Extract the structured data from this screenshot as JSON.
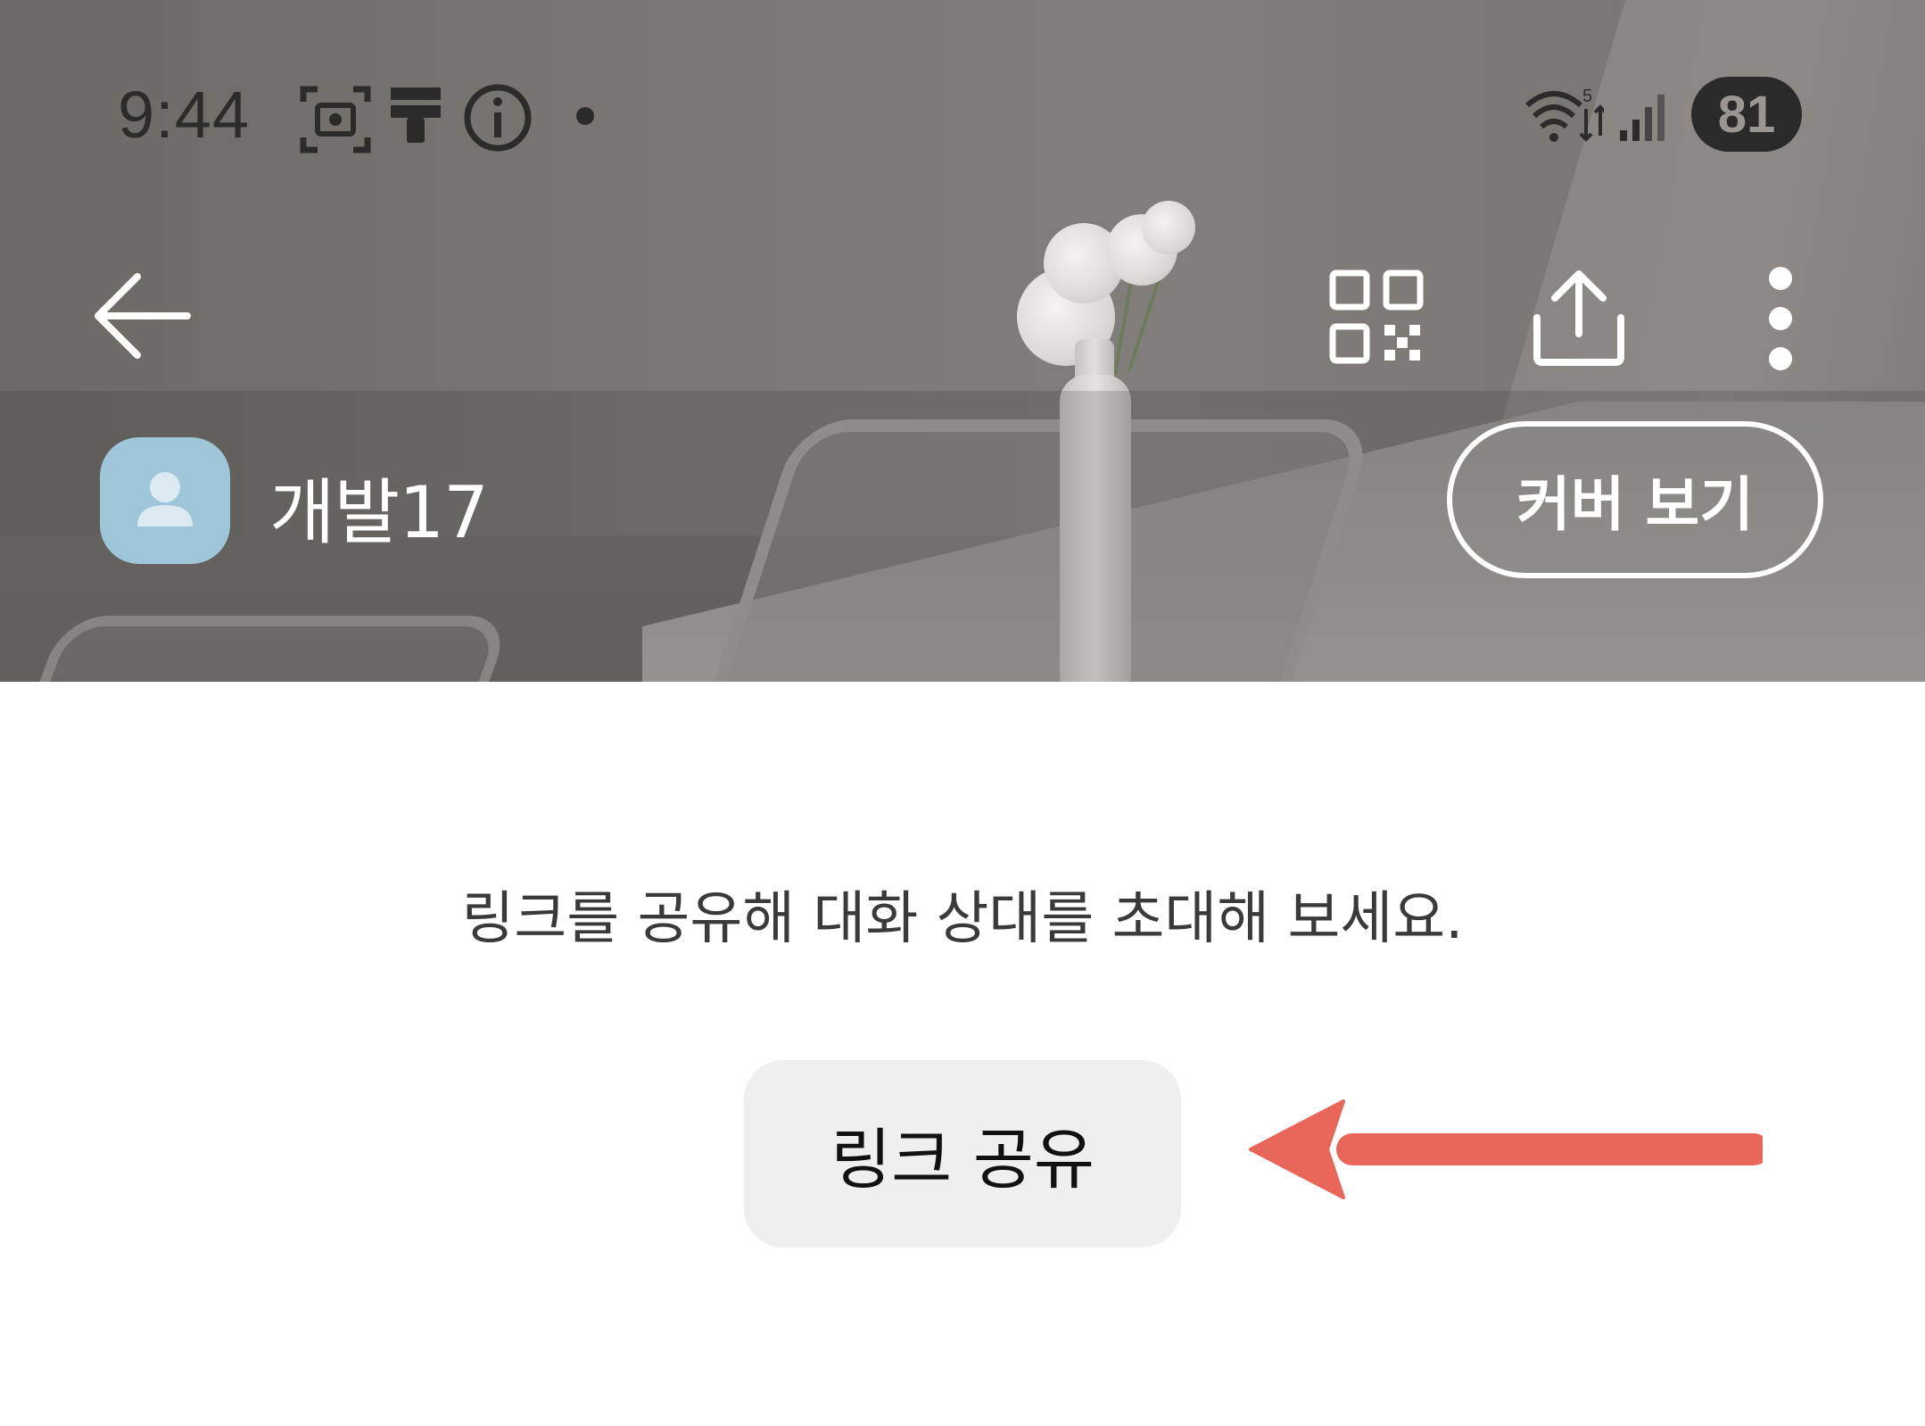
{
  "status_bar": {
    "time": "9:44",
    "battery": "81",
    "icons": [
      "screenshot-icon",
      "notification-icon",
      "info-icon",
      "dot-icon",
      "wifi-icon",
      "signal-icon"
    ]
  },
  "toolbar": {
    "icons": [
      "back-arrow-icon",
      "qr-code-icon",
      "share-icon",
      "more-vertical-icon"
    ]
  },
  "chat_header": {
    "room_name": "개발17",
    "cover_button_label": "커버 보기"
  },
  "body": {
    "invite_text": "링크를 공유해 대화 상대를 초대해 보세요.",
    "share_link_label": "링크 공유"
  },
  "annotation": {
    "arrow_color": "#e8675a"
  }
}
